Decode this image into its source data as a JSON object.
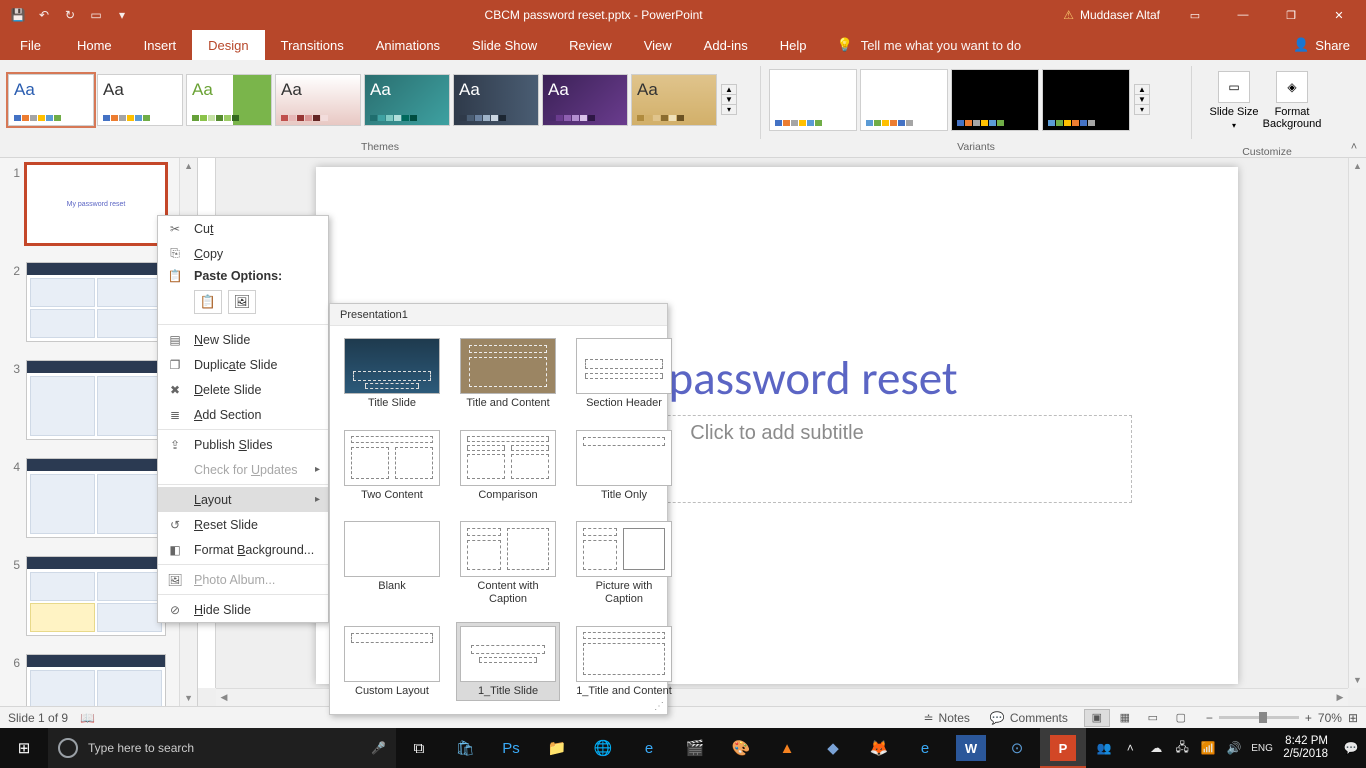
{
  "titlebar": {
    "doc_title": "CBCM password reset.pptx - PowerPoint",
    "user_name": "Muddaser Altaf"
  },
  "ribbon_tabs": [
    "File",
    "Home",
    "Insert",
    "Design",
    "Transitions",
    "Animations",
    "Slide Show",
    "Review",
    "View",
    "Add-ins",
    "Help"
  ],
  "active_tab_index": 3,
  "tellme_placeholder": "Tell me what you want to do",
  "share_label": "Share",
  "ribbon_groups": {
    "themes_label": "Themes",
    "variants_label": "Variants",
    "customize_label": "Customize",
    "slide_size_label": "Slide Size",
    "format_bg_label": "Format Background"
  },
  "context_menu": {
    "cut": "Cut",
    "copy": "Copy",
    "paste_options": "Paste Options:",
    "new_slide": "New Slide",
    "duplicate_slide": "Duplicate Slide",
    "delete_slide": "Delete Slide",
    "add_section": "Add Section",
    "publish_slides": "Publish Slides",
    "check_updates": "Check for Updates",
    "layout": "Layout",
    "reset_slide": "Reset Slide",
    "format_background": "Format Background...",
    "photo_album": "Photo Album...",
    "hide_slide": "Hide Slide"
  },
  "layout_gallery": {
    "header": "Presentation1",
    "items": [
      "Title Slide",
      "Title and Content",
      "Section Header",
      "Two Content",
      "Comparison",
      "Title Only",
      "Blank",
      "Content with Caption",
      "Picture with Caption",
      "Custom Layout",
      "1_Title Slide",
      "1_Title and Content"
    ],
    "selected_index": 10
  },
  "slide_panel": {
    "slide_numbers": [
      "1",
      "2",
      "3",
      "4",
      "5",
      "6"
    ],
    "selected_index": 0,
    "thumb1_text": "My password reset"
  },
  "canvas": {
    "title_text": "My password reset",
    "subtitle_placeholder": "Click to add subtitle"
  },
  "statusbar": {
    "slide_info": "Slide 1 of 9",
    "notes_label": "Notes",
    "comments_label": "Comments",
    "zoom_label": "70%"
  },
  "taskbar": {
    "search_placeholder": "Type here to search",
    "time": "8:42 PM",
    "date": "2/5/2018"
  }
}
